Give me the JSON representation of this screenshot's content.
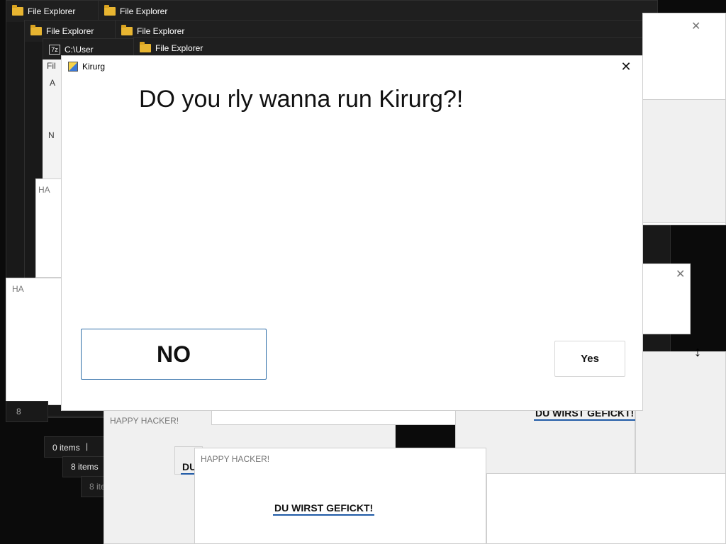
{
  "background_windows": {
    "file_explorer_title": "File Explorer",
    "path_text": "C:\\Users\\...",
    "cmd_title_fragment": "C:\\User",
    "items_count_0": "0 items",
    "items_count_8": "8 items",
    "items_count_8_alt": "8 ite",
    "items_count_frag": "8",
    "happy_title": "HAPPY HACKER!",
    "happy_fragment": "HA",
    "du_wirst": "DU WIRST GEFICKT!",
    "du_fragment": "DU",
    "side_letters": [
      "Fil",
      "A",
      "N"
    ]
  },
  "dialog": {
    "title": "Kirurg",
    "question": "DO you rly wanna run Kirurg?!",
    "no_label": "NO",
    "yes_label": "Yes",
    "close_glyph": "✕"
  },
  "glyphs": {
    "minimize": "—",
    "maximize": "☐",
    "close": "✕",
    "resize_cursor": "↕"
  },
  "colors": {
    "accent_blue": "#1f5aa6",
    "dark_bg": "#191919",
    "folder_yellow": "#e8b531"
  }
}
